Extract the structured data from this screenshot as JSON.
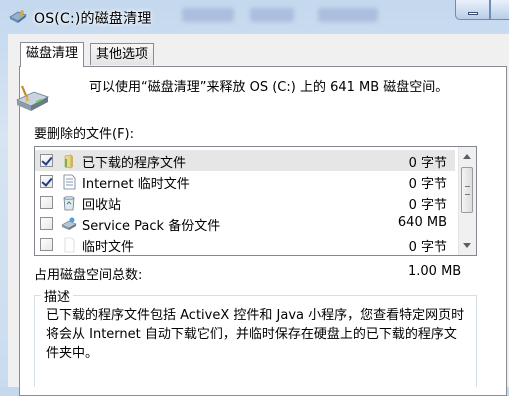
{
  "window": {
    "title": "OS(C:)的磁盘清理"
  },
  "tabs": [
    {
      "label": "磁盘清理",
      "active": true
    },
    {
      "label": "其他选项",
      "active": false
    }
  ],
  "intro": {
    "text": "可以使用“磁盘清理”来释放 OS (C:) 上的 641 MB 磁盘空间。"
  },
  "files": {
    "label": "要删除的文件(F):",
    "items": [
      {
        "name": "已下载的程序文件",
        "size": "0 字节",
        "checked": true,
        "selected": true,
        "icon": "folder-icon"
      },
      {
        "name": "Internet 临时文件",
        "size": "0 字节",
        "checked": true,
        "selected": false,
        "icon": "document-icon"
      },
      {
        "name": "回收站",
        "size": "0 字节",
        "checked": false,
        "selected": false,
        "icon": "recycle-bin-icon"
      },
      {
        "name": "Service Pack 备份文件",
        "size": "640 MB",
        "checked": false,
        "selected": false,
        "icon": "disk-icon"
      },
      {
        "name": "临时文件",
        "size": "0 字节",
        "checked": false,
        "selected": false,
        "icon": "blank-file-icon"
      }
    ]
  },
  "total": {
    "label": "占用磁盘空间总数:",
    "value": "1.00 MB"
  },
  "description": {
    "legend": "描述",
    "text": "已下载的程序文件包括 ActiveX 控件和 Java 小程序，您查看特定网页时将会从 Internet 自动下载它们，并临时保存在硬盘上的已下载的程序文件夹中。"
  },
  "colors": {
    "window_frame": "#c9dcef",
    "panel_background": "#ffffff",
    "dialog_background": "#f0f0f0",
    "checkmark": "#1f3c8a",
    "selected_row": "#e6e6e6"
  }
}
